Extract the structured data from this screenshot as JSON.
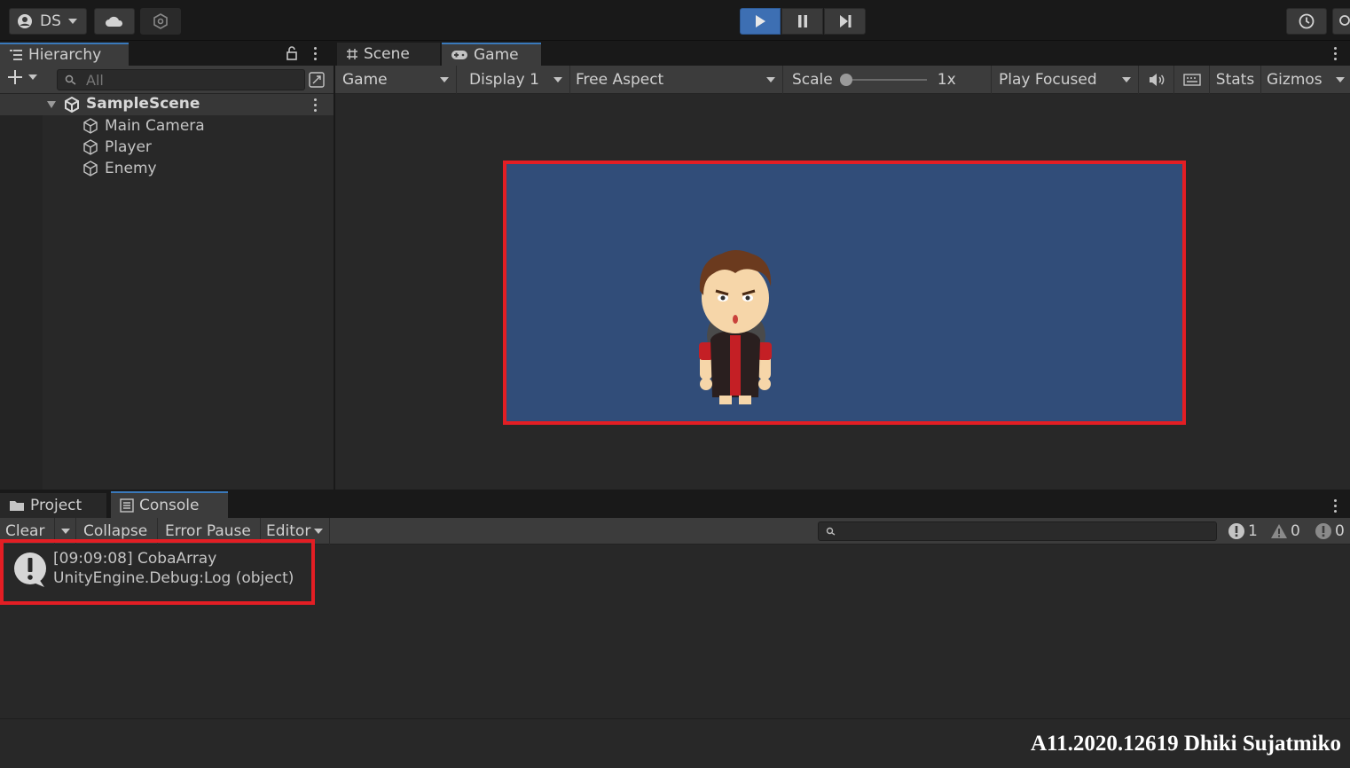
{
  "toolbar": {
    "account_label": "DS"
  },
  "hierarchy": {
    "tab_label": "Hierarchy",
    "search_placeholder": "All",
    "scene_name": "SampleScene",
    "items": [
      {
        "label": "Main Camera"
      },
      {
        "label": "Player"
      },
      {
        "label": "Enemy"
      }
    ]
  },
  "center": {
    "tabs": [
      {
        "label": "Scene"
      },
      {
        "label": "Game"
      }
    ],
    "game_toolbar": {
      "view_mode": "Game",
      "display": "Display 1",
      "aspect": "Free Aspect",
      "scale_label": "Scale",
      "scale_value": "1x",
      "play_mode": "Play Focused",
      "stats_label": "Stats",
      "gizmos_label": "Gizmos"
    },
    "game_view_color": "#314d79"
  },
  "bottom": {
    "tabs": [
      {
        "label": "Project"
      },
      {
        "label": "Console"
      }
    ],
    "console_toolbar": {
      "clear_label": "Clear",
      "collapse_label": "Collapse",
      "error_pause_label": "Error Pause",
      "editor_label": "Editor"
    },
    "counters": {
      "info": "1",
      "warnings": "0",
      "errors": "0"
    },
    "log": {
      "line1": "[09:09:08] CobaArray",
      "line2": "UnityEngine.Debug:Log (object)"
    }
  },
  "watermark": "A11.2020.12619 Dhiki Sujatmiko",
  "colors": {
    "accent": "#3d6fb3",
    "highlight": "#e31e24",
    "panel": "#282828"
  }
}
